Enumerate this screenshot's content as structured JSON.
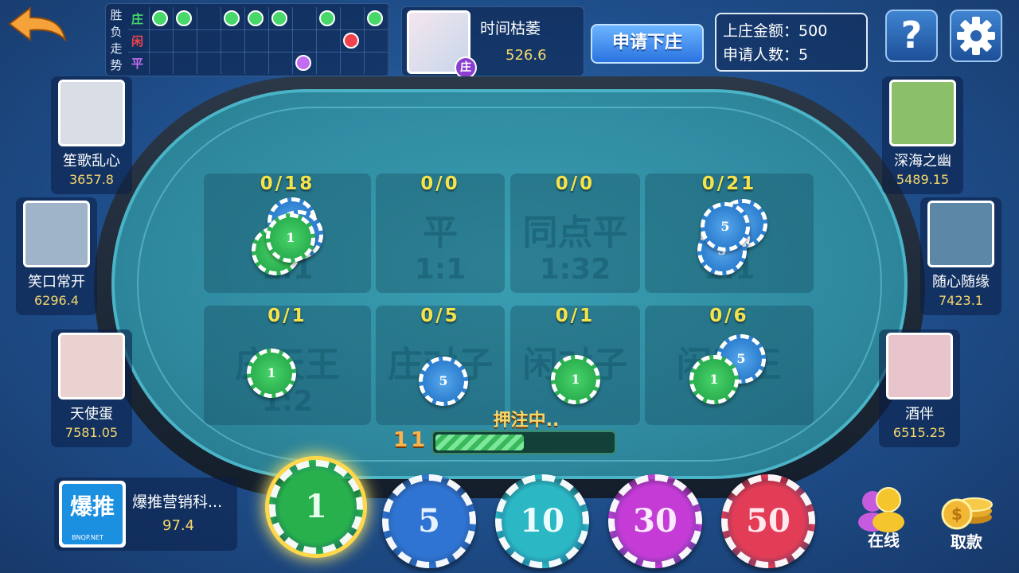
{
  "colors": {
    "banker": "#2fd05a",
    "player": "#e53935",
    "tie": "#a64de0",
    "gold": "#f6d76b",
    "count_yellow": "#f6e34a"
  },
  "trend": {
    "title": "胜负走势",
    "rows": [
      {
        "label": "庄",
        "color": "#48d86a"
      },
      {
        "label": "闲",
        "color": "#f0434d"
      },
      {
        "label": "平",
        "color": "#c26cf0"
      }
    ],
    "results": [
      "庄",
      "庄",
      "",
      "庄",
      "庄",
      "庄",
      "平",
      "庄",
      "闲",
      "庄"
    ]
  },
  "banker": {
    "name": "时间枯萎",
    "score": "526.6",
    "tag": "庄"
  },
  "apply_button": "申请下庄",
  "info": {
    "amount_label": "上庄金额：",
    "amount_value": "500",
    "applicants_label": "申请人数：",
    "applicants_value": "5"
  },
  "help_label": "?",
  "players_left": [
    {
      "name": "笙歌乱心",
      "score": "3657.8",
      "avatar_color": "#d8dde6"
    },
    {
      "name": "笑口常开",
      "score": "6296.4",
      "avatar_color": "#9fb4c9"
    },
    {
      "name": "天使蛋",
      "score": "7581.05",
      "avatar_color": "#e9d2cf"
    }
  ],
  "players_right": [
    {
      "name": "深海之幽",
      "score": "5489.15",
      "avatar_color": "#8bbf6a"
    },
    {
      "name": "随心随缘",
      "score": "7423.1",
      "avatar_color": "#5c87a6"
    },
    {
      "name": "酒伴",
      "score": "6515.25",
      "avatar_color": "#e8c4cc"
    }
  ],
  "bet_areas": [
    {
      "count": "0/18",
      "label": "",
      "odds": "1:1"
    },
    {
      "count": "0/0",
      "label": "平",
      "odds": "1:1"
    },
    {
      "count": "0/0",
      "label": "同点平",
      "odds": "1:32"
    },
    {
      "count": "0/21",
      "label": "",
      "odds": "1:1"
    },
    {
      "count": "0/1",
      "label": "庄天王",
      "odds": "1:2"
    },
    {
      "count": "0/5",
      "label": "庄对子",
      "odds": ""
    },
    {
      "count": "0/1",
      "label": "闲对子",
      "odds": ""
    },
    {
      "count": "0/6",
      "label": "闲天王",
      "odds": ""
    }
  ],
  "status": {
    "label": "押注中..",
    "timer": "11",
    "progress": 0.5
  },
  "me": {
    "name": "爆推营销科...",
    "score": "97.4",
    "logo_text": "爆推",
    "logo_sub": "BNQP.NET"
  },
  "chips": [
    {
      "value": "1",
      "color": "#27b04c",
      "text_color": "#e8fff0",
      "selected": true
    },
    {
      "value": "5",
      "color": "#2f74d2",
      "text_color": "#e8f2ff",
      "selected": false
    },
    {
      "value": "10",
      "color": "#2bb7c4",
      "text_color": "#eafcff",
      "selected": false
    },
    {
      "value": "30",
      "color": "#c43bd6",
      "text_color": "#fbe9ff",
      "selected": false
    },
    {
      "value": "50",
      "color": "#e23c56",
      "text_color": "#ffe9ee",
      "selected": false
    }
  ],
  "online_label": "在线",
  "withdraw_label": "取款"
}
